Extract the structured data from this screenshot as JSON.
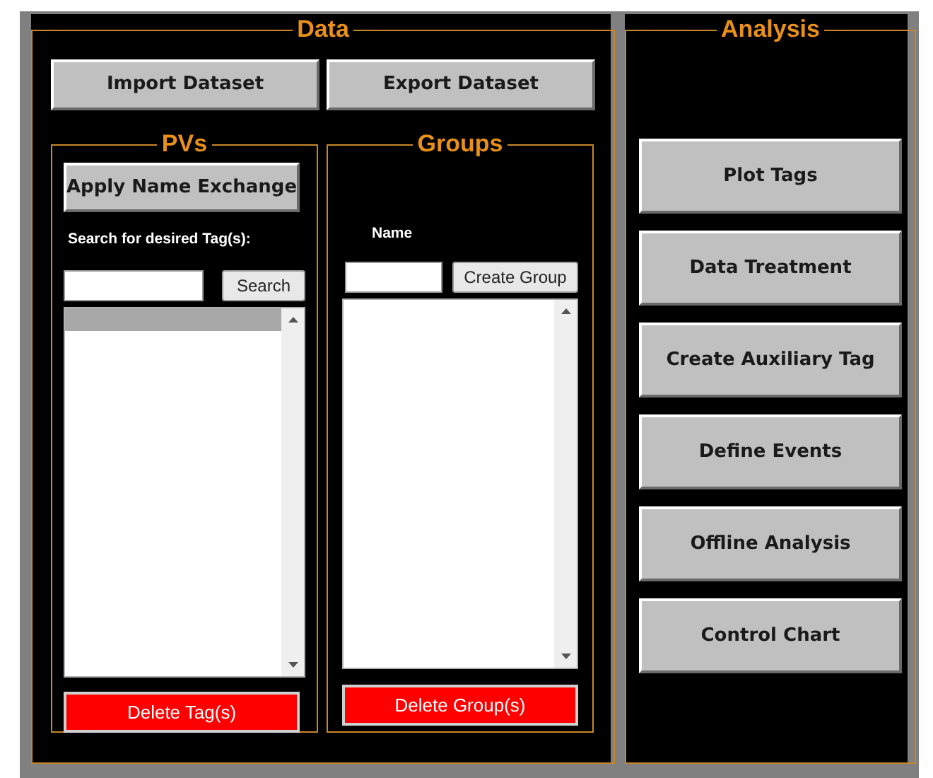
{
  "data_panel": {
    "title": "Data",
    "buttons": [
      "Import Dataset",
      "Export Dataset"
    ]
  },
  "pvs": {
    "title": "PVs",
    "apply_button": "Apply Name Exchange",
    "search_label": "Search for desired Tag(s):",
    "search_button": "Search",
    "list": {
      "first_row_selected": true
    },
    "delete_button": "Delete Tag(s)"
  },
  "groups": {
    "title": "Groups",
    "name_label": "Name",
    "create_button": "Create Group",
    "delete_button": "Delete Group(s)"
  },
  "analysis_panel": {
    "title": "Analysis",
    "buttons": [
      "Plot Tags",
      "Data Treatment",
      "Create Auxiliary Tag",
      "Define Events",
      "Offline Analysis",
      "Control Chart"
    ]
  }
}
